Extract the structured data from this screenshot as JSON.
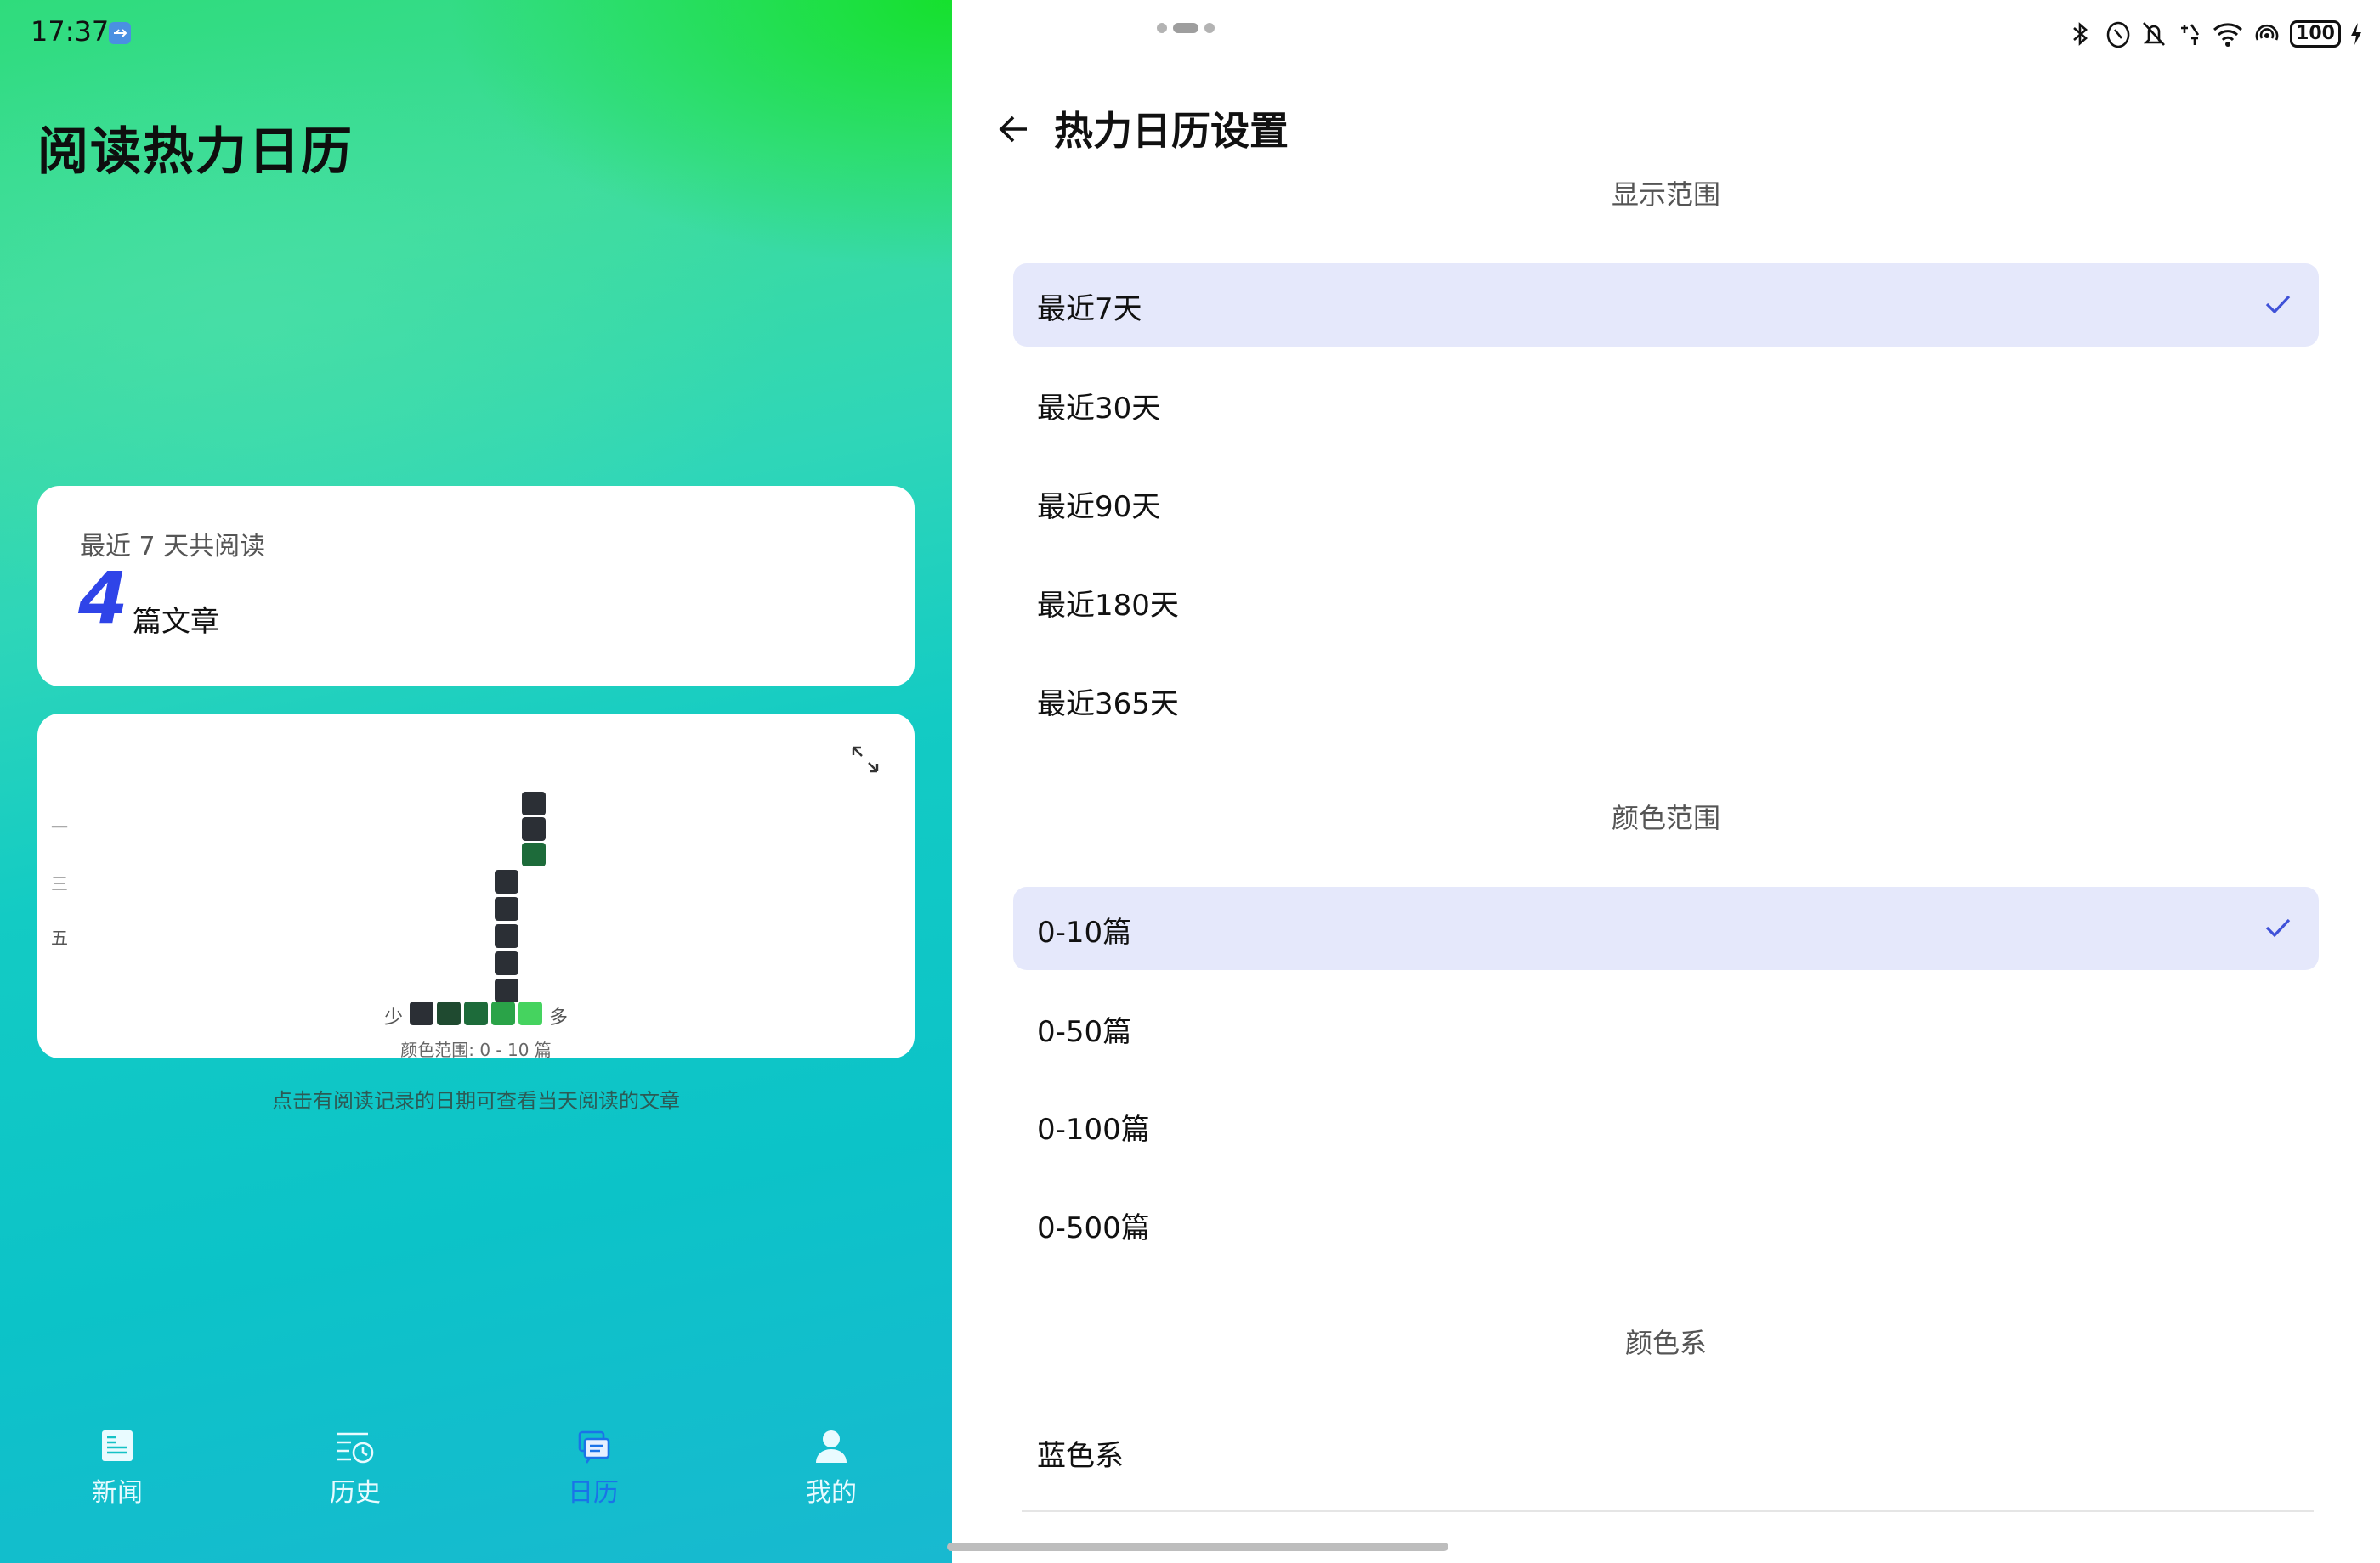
{
  "status_bar": {
    "time": "17:37",
    "battery": "100"
  },
  "left": {
    "title": "阅读热力日历",
    "summary": {
      "caption": "最近 7 天共阅读",
      "count": "4",
      "unit": "篇文章"
    },
    "heatmap": {
      "weekday_labels": [
        "一",
        "三",
        "五"
      ],
      "legend_low": "少",
      "legend_high": "多",
      "legend_colors": [
        "#2b2f35",
        "#1f4a30",
        "#1d6b3a",
        "#2aa348",
        "#45d35f"
      ],
      "empty_color": "#2b2f35",
      "active_color": "#1d6b3a",
      "range_note": "颜色范围: 0 - 10 篇"
    },
    "hint": "点击有阅读记录的日期可查看当天阅读的文章",
    "tabs": [
      {
        "label": "新闻",
        "icon": "news-icon"
      },
      {
        "label": "历史",
        "icon": "history-icon"
      },
      {
        "label": "日历",
        "icon": "calendar-icon",
        "active": true
      },
      {
        "label": "我的",
        "icon": "profile-icon"
      }
    ],
    "accent_color": "#1a73e8"
  },
  "right": {
    "title": "热力日历设置",
    "sections": [
      {
        "header": "显示范围",
        "options": [
          "最近7天",
          "最近30天",
          "最近90天",
          "最近180天",
          "最近365天"
        ],
        "selected": "最近7天"
      },
      {
        "header": "颜色范围",
        "options": [
          "0-10篇",
          "0-50篇",
          "0-100篇",
          "0-500篇"
        ],
        "selected": "0-10篇"
      },
      {
        "header": "颜色系",
        "options": [
          "蓝色系"
        ]
      }
    ],
    "selection_color": "#e5e8fb",
    "check_color": "#3f51d8"
  }
}
